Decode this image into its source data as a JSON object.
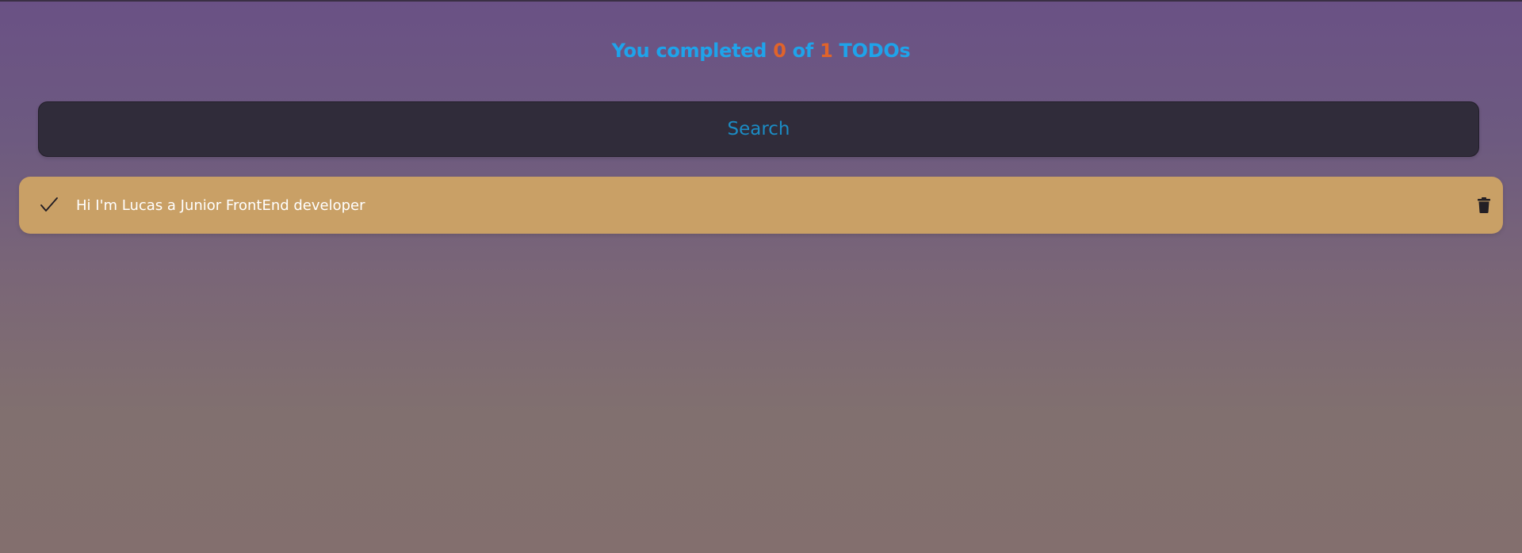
{
  "header": {
    "prefix": "You completed",
    "completed": "0",
    "middle": "of",
    "total": "1",
    "suffix": "TODOs"
  },
  "search": {
    "placeholder": "Search",
    "value": ""
  },
  "todos": [
    {
      "text": "Hi I'm Lucas a Junior FrontEnd developer",
      "completed": false,
      "check_icon": "check-icon",
      "delete_icon": "trash-icon"
    }
  ],
  "colors": {
    "counter_text": "#1fa3ea",
    "counter_number": "#e0632a",
    "search_bg": "#302c3a",
    "search_text": "#1b8cc4",
    "todo_bg": "#c9a066",
    "todo_text": "#ffffff"
  }
}
